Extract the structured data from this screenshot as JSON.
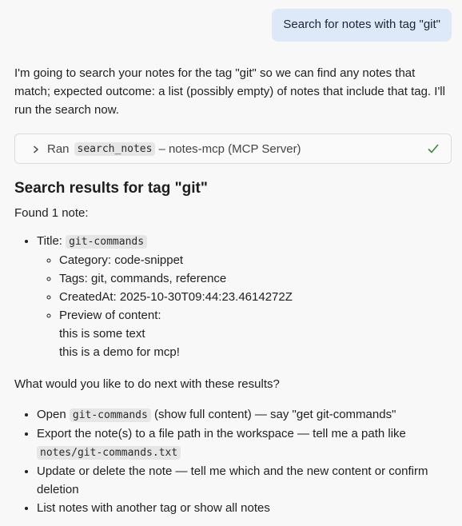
{
  "user_message": "Search for notes with tag \"git\"",
  "assistant": {
    "intro": "I'm going to search your notes for the tag \"git\" so we can find any notes that match; expected outcome: a list (possibly empty) of notes that include that tag. I'll run the search now.",
    "tool_call": {
      "prefix": "Ran",
      "tool_name": "search_notes",
      "suffix": "– notes-mcp (MCP Server)",
      "status_icon": "checkmark-icon",
      "status_color": "#3a8a3a"
    },
    "results_heading": "Search results for tag \"git\"",
    "found_text": "Found 1 note:",
    "note": {
      "title_label": "Title:",
      "title_value": "git-commands",
      "category": "Category: code-snippet",
      "tags": "Tags: git, commands, reference",
      "created_at": "CreatedAt: 2025-10-30T09:44:23.4614272Z",
      "preview_label": "Preview of content:",
      "preview_line_1": "this is some text",
      "preview_line_2": "this is a demo for mcp!"
    },
    "next_question": "What would you like to do next with these results?",
    "options": {
      "open_prefix": "Open",
      "open_code": "git-commands",
      "open_suffix": "(show full content) — say \"get git-commands\"",
      "export_text": "Export the note(s) to a file path in the workspace — tell me a path like",
      "export_code": "notes/git-commands.txt",
      "update_text": "Update or delete the note — tell me which and the new content or confirm deletion",
      "list_text": "List notes with another tag or show all notes"
    }
  }
}
